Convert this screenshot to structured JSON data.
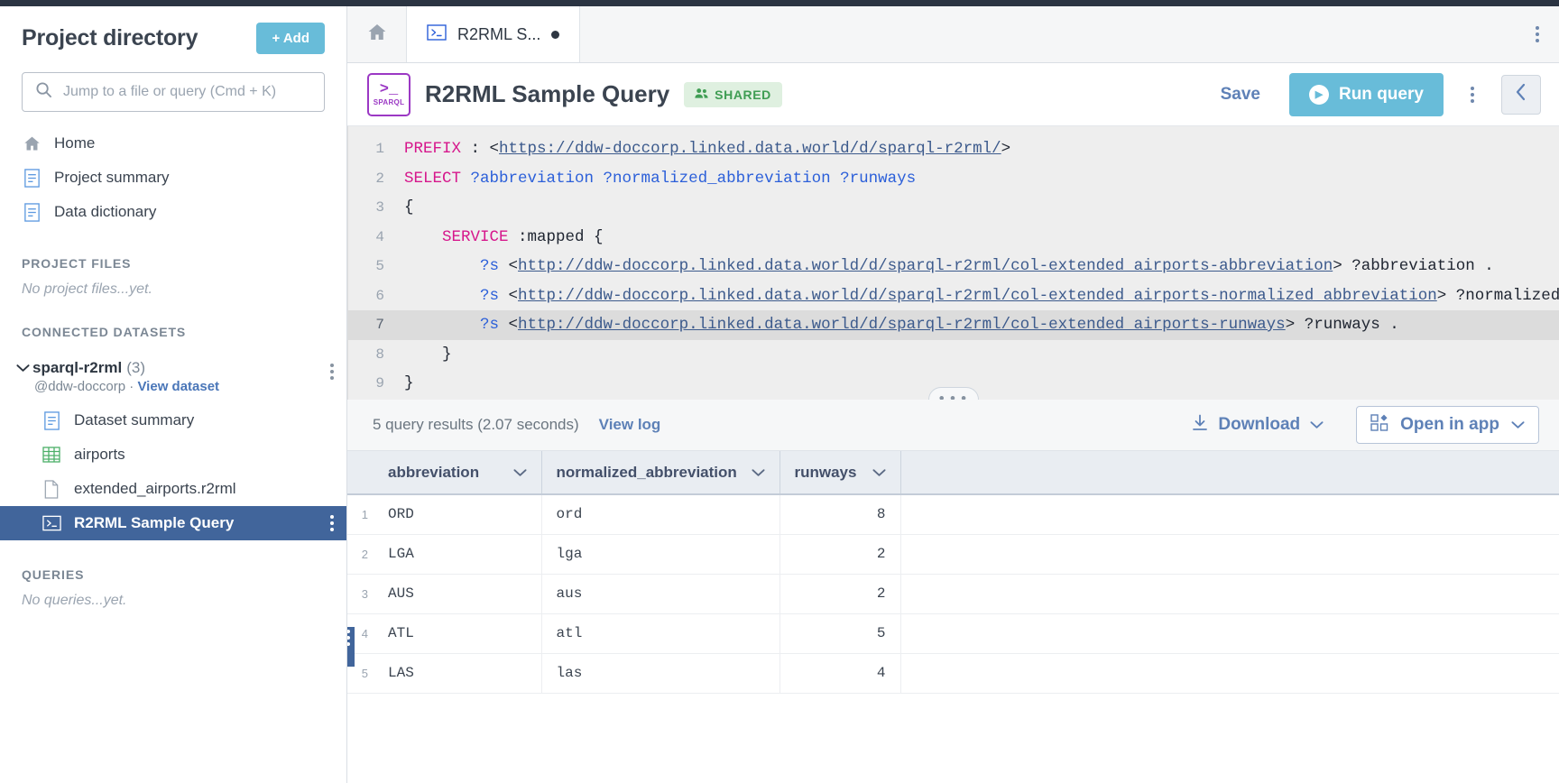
{
  "sidebar": {
    "title": "Project directory",
    "add_label": "+ Add",
    "search_placeholder": "Jump to a file or query (Cmd + K)",
    "search_value": "",
    "nav": [
      {
        "label": "Home",
        "icon": "home-icon"
      },
      {
        "label": "Project summary",
        "icon": "document-icon"
      },
      {
        "label": "Data dictionary",
        "icon": "document-icon"
      }
    ],
    "project_files": {
      "heading": "PROJECT FILES",
      "empty": "No project files...yet."
    },
    "connected_datasets": {
      "heading": "CONNECTED DATASETS",
      "dataset_name": "sparql-r2rml",
      "dataset_count": "(3)",
      "owner": "@ddw-doccorp",
      "separator": "·",
      "view_dataset": "View dataset",
      "children": [
        {
          "label": "Dataset summary",
          "icon": "document-icon",
          "active": false
        },
        {
          "label": "airports",
          "icon": "table-icon",
          "active": false
        },
        {
          "label": "extended_airports.r2rml",
          "icon": "file-icon",
          "active": false
        },
        {
          "label": "R2RML Sample Query",
          "icon": "sparql-icon",
          "active": true
        }
      ]
    },
    "queries": {
      "heading": "QUERIES",
      "empty": "No queries...yet."
    }
  },
  "tabbar": {
    "home_icon": "home-icon",
    "tabs": [
      {
        "label": "R2RML S...",
        "icon": "sparql-icon",
        "unsaved": true
      }
    ],
    "overflow_icon": "kebab-icon"
  },
  "query_header": {
    "badge_glyph": ">_",
    "badge_label": "SPARQL",
    "title": "R2RML Sample Query",
    "shared_label": "SHARED",
    "save_label": "Save",
    "run_label": "Run query",
    "kebab_icon": "kebab-icon",
    "collapse_icon": "chevron-left-icon"
  },
  "editor": {
    "highlighted_line": 7,
    "lines": [
      {
        "n": "1",
        "tokens": [
          {
            "t": "PREFIX",
            "c": "kw"
          },
          {
            "t": " : ",
            "c": "pfx"
          },
          {
            "t": "<",
            "c": "pfx"
          },
          {
            "t": "https://ddw-doccorp.linked.data.world/d/sparql-r2rml/",
            "c": "uri"
          },
          {
            "t": ">",
            "c": "pfx"
          }
        ]
      },
      {
        "n": "2",
        "tokens": [
          {
            "t": "SELECT",
            "c": "kw"
          },
          {
            "t": " ",
            "c": "pfx"
          },
          {
            "t": "?abbreviation ?normalized_abbreviation ?runways",
            "c": "var"
          }
        ]
      },
      {
        "n": "3",
        "tokens": [
          {
            "t": "{",
            "c": "pfx"
          }
        ]
      },
      {
        "n": "4",
        "tokens": [
          {
            "t": "    SERVICE",
            "c": "kw"
          },
          {
            "t": " :mapped {",
            "c": "pfx"
          }
        ]
      },
      {
        "n": "5",
        "tokens": [
          {
            "t": "        ",
            "c": "pfx"
          },
          {
            "t": "?s",
            "c": "var"
          },
          {
            "t": " <",
            "c": "pfx"
          },
          {
            "t": "http://ddw-doccorp.linked.data.world/d/sparql-r2rml/col-extended_airports-abbreviation",
            "c": "uri"
          },
          {
            "t": "> ?abbreviation .",
            "c": "pfx"
          }
        ]
      },
      {
        "n": "6",
        "tokens": [
          {
            "t": "        ",
            "c": "pfx"
          },
          {
            "t": "?s",
            "c": "var"
          },
          {
            "t": " <",
            "c": "pfx"
          },
          {
            "t": "http://ddw-doccorp.linked.data.world/d/sparql-r2rml/col-extended_airports-normalized_abbreviation",
            "c": "uri"
          },
          {
            "t": "> ?normalized_abbreviation .",
            "c": "pfx"
          }
        ]
      },
      {
        "n": "7",
        "tokens": [
          {
            "t": "        ",
            "c": "pfx"
          },
          {
            "t": "?s",
            "c": "var"
          },
          {
            "t": " <",
            "c": "pfx"
          },
          {
            "t": "http://ddw-doccorp.linked.data.world/d/sparql-r2rml/col-extended_airports-runways",
            "c": "uri"
          },
          {
            "t": "> ?runways .",
            "c": "pfx"
          }
        ]
      },
      {
        "n": "8",
        "tokens": [
          {
            "t": "    }",
            "c": "pfx"
          }
        ]
      },
      {
        "n": "9",
        "tokens": [
          {
            "t": "}",
            "c": "pfx"
          }
        ]
      }
    ],
    "resize_handle": "•••"
  },
  "results_bar": {
    "summary": "5 query results (2.07 seconds)",
    "view_log": "View log",
    "download_label": "Download",
    "open_in_app_label": "Open in app"
  },
  "results_table": {
    "columns": [
      "abbreviation",
      "normalized_abbreviation",
      "runways"
    ],
    "rows": [
      {
        "n": "1",
        "abbreviation": "ORD",
        "normalized_abbreviation": "ord",
        "runways": "8"
      },
      {
        "n": "2",
        "abbreviation": "LGA",
        "normalized_abbreviation": "lga",
        "runways": "2"
      },
      {
        "n": "3",
        "abbreviation": "AUS",
        "normalized_abbreviation": "aus",
        "runways": "2"
      },
      {
        "n": "4",
        "abbreviation": "ATL",
        "normalized_abbreviation": "atl",
        "runways": "5"
      },
      {
        "n": "5",
        "abbreviation": "LAS",
        "normalized_abbreviation": "las",
        "runways": "4"
      }
    ]
  },
  "colors": {
    "accent": "#68bcd9",
    "link": "#5e81b7",
    "active_nav": "#41659b",
    "sparql_purple": "#9b38c4",
    "shared_green": "#3f9d53",
    "keyword_pink": "#d6178c"
  }
}
